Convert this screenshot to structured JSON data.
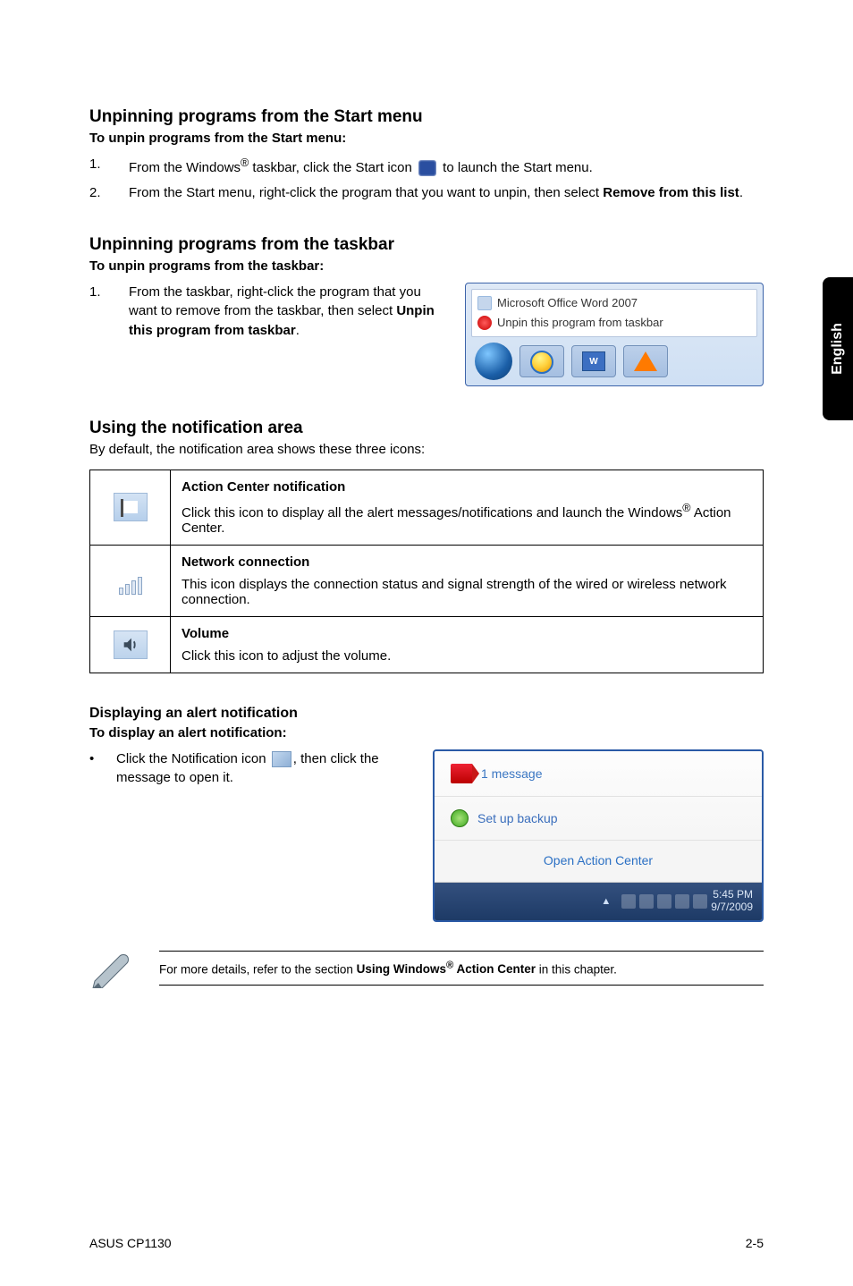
{
  "sideTab": "English",
  "sec1": {
    "heading": "Unpinning programs from the Start menu",
    "sub": "To unpin programs from the Start menu:",
    "step1_num": "1.",
    "step1_a": "From the Windows",
    "step1_reg": "®",
    "step1_b": " taskbar, click the Start icon ",
    "step1_c": " to launch the Start menu.",
    "step2_num": "2.",
    "step2_a": "From the Start menu, right-click the program that you want to unpin, then select ",
    "step2_bold": "Remove from this list",
    "step2_b": "."
  },
  "sec2": {
    "heading": "Unpinning programs from the taskbar",
    "sub": "To unpin programs from the taskbar:",
    "step1_num": "1.",
    "step1_a": "From the taskbar, right-click the program that you want to remove from the taskbar, then select ",
    "step1_bold": "Unpin this program from taskbar",
    "step1_b": ".",
    "ss": {
      "row1": "Microsoft Office Word 2007",
      "row2": "Unpin this program from taskbar"
    }
  },
  "sec3": {
    "heading": "Using the notification area",
    "intro": "By default, the notification area shows these three icons:",
    "rows": [
      {
        "title": "Action Center notification",
        "desc_a": "Click this icon to display all the alert messages/notifications and launch the Windows",
        "desc_reg": "®",
        "desc_b": " Action Center."
      },
      {
        "title": "Network connection",
        "desc_a": "This icon displays the connection status and signal strength of the wired or wireless network connection.",
        "desc_reg": "",
        "desc_b": ""
      },
      {
        "title": "Volume",
        "desc_a": "Click this icon to adjust the volume.",
        "desc_reg": "",
        "desc_b": ""
      }
    ]
  },
  "sec4": {
    "heading": "Displaying an alert notification",
    "sub": "To display an alert notification:",
    "bullet": "•",
    "txt_a": "Click the Notification icon ",
    "txt_b": ", then click the message to open it.",
    "ss": {
      "msg": "1 message",
      "backup": "Set up backup",
      "action": "Open Action Center",
      "time": "5:45 PM",
      "date": "9/7/2009"
    }
  },
  "note_a": "For more details, refer to the section ",
  "note_bold_a": "Using Windows",
  "note_reg": "®",
  "note_bold_b": " Action Center",
  "note_b": " in this chapter.",
  "footer_left": "ASUS CP1130",
  "footer_right": "2-5"
}
